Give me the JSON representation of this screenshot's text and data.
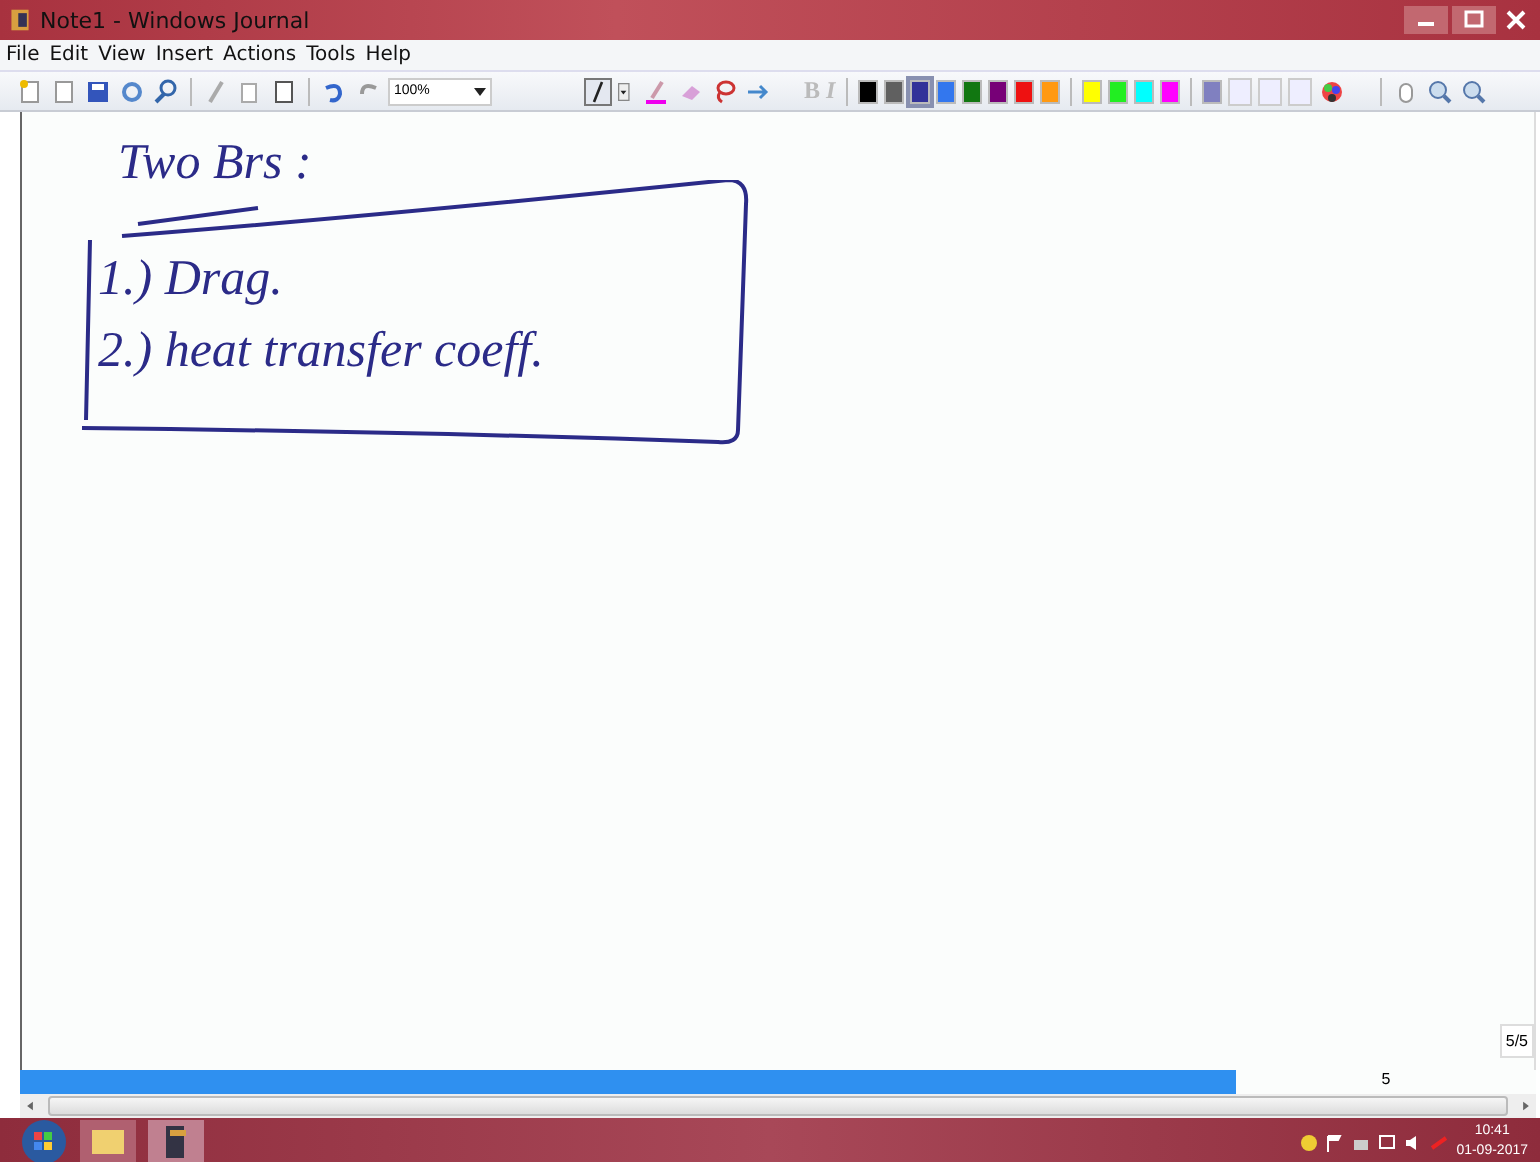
{
  "window": {
    "title": "Note1 - Windows Journal"
  },
  "menu": [
    "File",
    "Edit",
    "View",
    "Insert",
    "Actions",
    "Tools",
    "Help"
  ],
  "toolbar": {
    "zoom": "100%",
    "format_buttons": [
      "B",
      "I"
    ],
    "pen_colors": [
      {
        "color": "#000000",
        "selected": false
      },
      {
        "color": "#606060",
        "selected": false
      },
      {
        "color": "#333399",
        "selected": true
      },
      {
        "color": "#3377ee",
        "selected": false
      },
      {
        "color": "#117711",
        "selected": false
      },
      {
        "color": "#770077",
        "selected": false
      },
      {
        "color": "#ee1111",
        "selected": false
      },
      {
        "color": "#ff9911",
        "selected": false
      },
      {
        "color": "#ffff00",
        "selected": false
      },
      {
        "color": "#22ee22",
        "selected": false
      },
      {
        "color": "#00ffff",
        "selected": false
      },
      {
        "color": "#ff00ff",
        "selected": false
      },
      {
        "color": "#8080c0",
        "selected": false
      }
    ]
  },
  "note": {
    "heading": "Two Brs :",
    "items": [
      "1.) Drag.",
      "2.) heat transfer coeff."
    ]
  },
  "page_indicator": "5/5",
  "page_number": "5",
  "taskbar": {
    "time": "10:41",
    "date": "01-09-2017"
  }
}
